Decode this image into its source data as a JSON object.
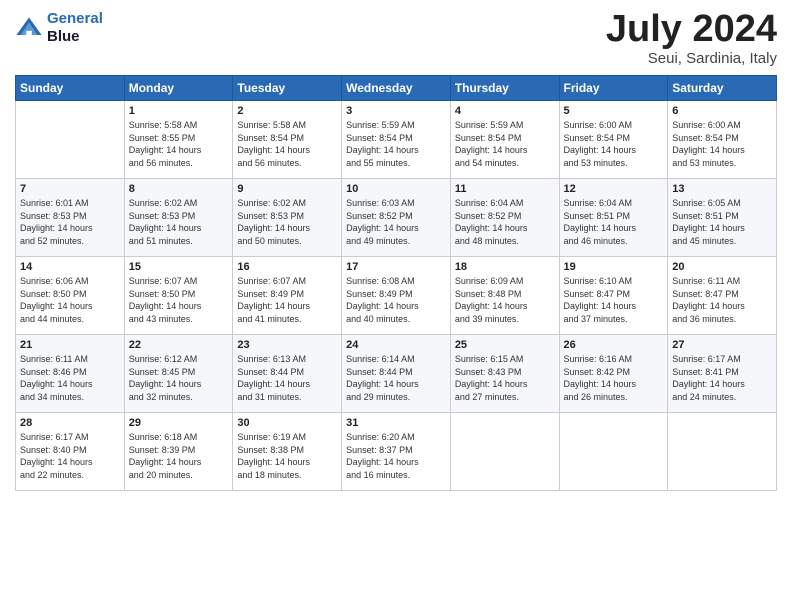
{
  "logo": {
    "line1": "General",
    "line2": "Blue"
  },
  "title": "July 2024",
  "location": "Seui, Sardinia, Italy",
  "days_header": [
    "Sunday",
    "Monday",
    "Tuesday",
    "Wednesday",
    "Thursday",
    "Friday",
    "Saturday"
  ],
  "weeks": [
    [
      {
        "day": "",
        "content": ""
      },
      {
        "day": "1",
        "content": "Sunrise: 5:58 AM\nSunset: 8:55 PM\nDaylight: 14 hours\nand 56 minutes."
      },
      {
        "day": "2",
        "content": "Sunrise: 5:58 AM\nSunset: 8:54 PM\nDaylight: 14 hours\nand 56 minutes."
      },
      {
        "day": "3",
        "content": "Sunrise: 5:59 AM\nSunset: 8:54 PM\nDaylight: 14 hours\nand 55 minutes."
      },
      {
        "day": "4",
        "content": "Sunrise: 5:59 AM\nSunset: 8:54 PM\nDaylight: 14 hours\nand 54 minutes."
      },
      {
        "day": "5",
        "content": "Sunrise: 6:00 AM\nSunset: 8:54 PM\nDaylight: 14 hours\nand 53 minutes."
      },
      {
        "day": "6",
        "content": "Sunrise: 6:00 AM\nSunset: 8:54 PM\nDaylight: 14 hours\nand 53 minutes."
      }
    ],
    [
      {
        "day": "7",
        "content": "Sunrise: 6:01 AM\nSunset: 8:53 PM\nDaylight: 14 hours\nand 52 minutes."
      },
      {
        "day": "8",
        "content": "Sunrise: 6:02 AM\nSunset: 8:53 PM\nDaylight: 14 hours\nand 51 minutes."
      },
      {
        "day": "9",
        "content": "Sunrise: 6:02 AM\nSunset: 8:53 PM\nDaylight: 14 hours\nand 50 minutes."
      },
      {
        "day": "10",
        "content": "Sunrise: 6:03 AM\nSunset: 8:52 PM\nDaylight: 14 hours\nand 49 minutes."
      },
      {
        "day": "11",
        "content": "Sunrise: 6:04 AM\nSunset: 8:52 PM\nDaylight: 14 hours\nand 48 minutes."
      },
      {
        "day": "12",
        "content": "Sunrise: 6:04 AM\nSunset: 8:51 PM\nDaylight: 14 hours\nand 46 minutes."
      },
      {
        "day": "13",
        "content": "Sunrise: 6:05 AM\nSunset: 8:51 PM\nDaylight: 14 hours\nand 45 minutes."
      }
    ],
    [
      {
        "day": "14",
        "content": "Sunrise: 6:06 AM\nSunset: 8:50 PM\nDaylight: 14 hours\nand 44 minutes."
      },
      {
        "day": "15",
        "content": "Sunrise: 6:07 AM\nSunset: 8:50 PM\nDaylight: 14 hours\nand 43 minutes."
      },
      {
        "day": "16",
        "content": "Sunrise: 6:07 AM\nSunset: 8:49 PM\nDaylight: 14 hours\nand 41 minutes."
      },
      {
        "day": "17",
        "content": "Sunrise: 6:08 AM\nSunset: 8:49 PM\nDaylight: 14 hours\nand 40 minutes."
      },
      {
        "day": "18",
        "content": "Sunrise: 6:09 AM\nSunset: 8:48 PM\nDaylight: 14 hours\nand 39 minutes."
      },
      {
        "day": "19",
        "content": "Sunrise: 6:10 AM\nSunset: 8:47 PM\nDaylight: 14 hours\nand 37 minutes."
      },
      {
        "day": "20",
        "content": "Sunrise: 6:11 AM\nSunset: 8:47 PM\nDaylight: 14 hours\nand 36 minutes."
      }
    ],
    [
      {
        "day": "21",
        "content": "Sunrise: 6:11 AM\nSunset: 8:46 PM\nDaylight: 14 hours\nand 34 minutes."
      },
      {
        "day": "22",
        "content": "Sunrise: 6:12 AM\nSunset: 8:45 PM\nDaylight: 14 hours\nand 32 minutes."
      },
      {
        "day": "23",
        "content": "Sunrise: 6:13 AM\nSunset: 8:44 PM\nDaylight: 14 hours\nand 31 minutes."
      },
      {
        "day": "24",
        "content": "Sunrise: 6:14 AM\nSunset: 8:44 PM\nDaylight: 14 hours\nand 29 minutes."
      },
      {
        "day": "25",
        "content": "Sunrise: 6:15 AM\nSunset: 8:43 PM\nDaylight: 14 hours\nand 27 minutes."
      },
      {
        "day": "26",
        "content": "Sunrise: 6:16 AM\nSunset: 8:42 PM\nDaylight: 14 hours\nand 26 minutes."
      },
      {
        "day": "27",
        "content": "Sunrise: 6:17 AM\nSunset: 8:41 PM\nDaylight: 14 hours\nand 24 minutes."
      }
    ],
    [
      {
        "day": "28",
        "content": "Sunrise: 6:17 AM\nSunset: 8:40 PM\nDaylight: 14 hours\nand 22 minutes."
      },
      {
        "day": "29",
        "content": "Sunrise: 6:18 AM\nSunset: 8:39 PM\nDaylight: 14 hours\nand 20 minutes."
      },
      {
        "day": "30",
        "content": "Sunrise: 6:19 AM\nSunset: 8:38 PM\nDaylight: 14 hours\nand 18 minutes."
      },
      {
        "day": "31",
        "content": "Sunrise: 6:20 AM\nSunset: 8:37 PM\nDaylight: 14 hours\nand 16 minutes."
      },
      {
        "day": "",
        "content": ""
      },
      {
        "day": "",
        "content": ""
      },
      {
        "day": "",
        "content": ""
      }
    ]
  ]
}
